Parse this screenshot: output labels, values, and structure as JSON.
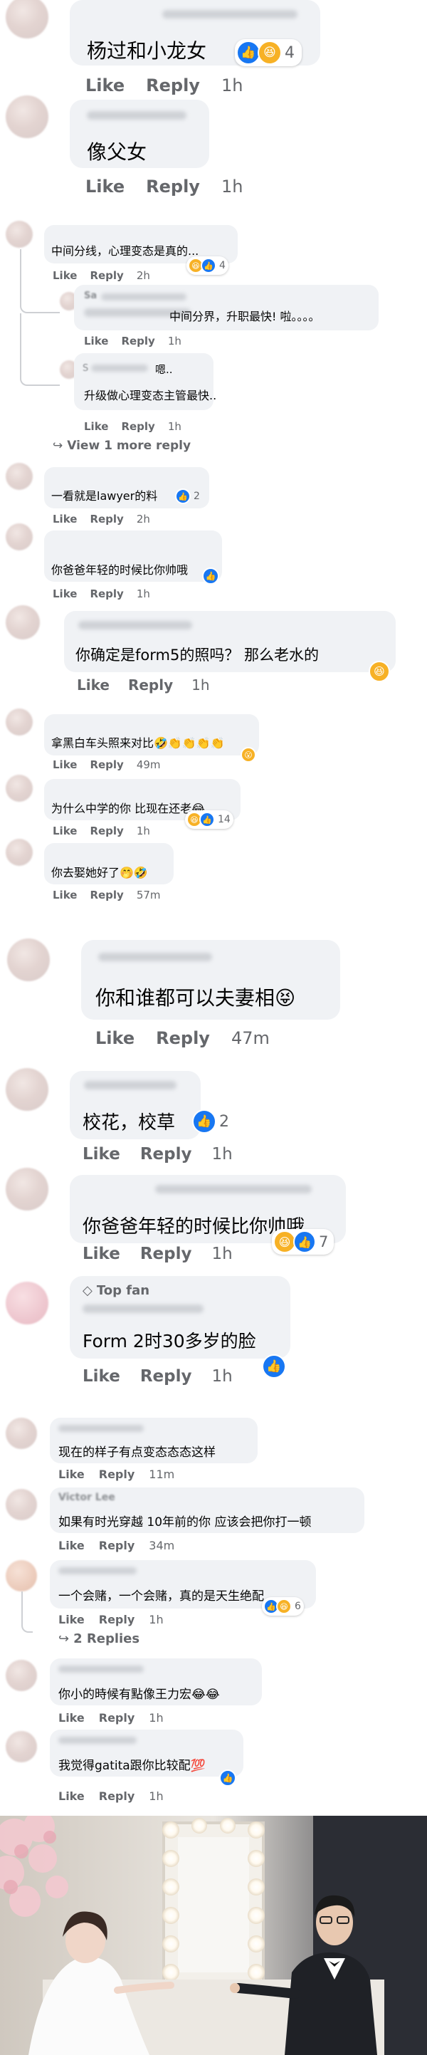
{
  "actions": {
    "like": "Like",
    "reply": "Reply"
  },
  "comments": [
    {
      "text": "杨过和小龙女",
      "time": "1h",
      "react_count": "4"
    },
    {
      "text": "像父女",
      "time": "1h"
    },
    {
      "text": "中间分线，心理变态是真的...",
      "time": "2h",
      "react_count": "4",
      "replies": [
        {
          "name_fragment": "Sa",
          "text": "中间分界，升职最快! 啦。。。。",
          "time": "1h"
        },
        {
          "name_fragment": "S",
          "name_suffix": "嗯..",
          "text": "升级做心理变态主管最快..",
          "time": "1h"
        }
      ],
      "view_more": "View 1 more reply"
    },
    {
      "text": "一看就是lawyer的料",
      "time": "2h",
      "react_count": "2"
    },
    {
      "text": "你爸爸年轻的时候比你帅哦",
      "time": "1h"
    },
    {
      "text": "你确定是form5的照吗？ 那么老水的",
      "time": "1h"
    },
    {
      "text": "拿黑白车头照来对比🤣👏👏👏👏",
      "time": "49m"
    },
    {
      "text": "为什么中学的你 比现在还老😂",
      "time": "1h",
      "react_count": "14"
    },
    {
      "text": "你去娶她好了🤭🤣",
      "time": "57m"
    },
    {
      "text": "你和谁都可以夫妻相😝",
      "time": "47m"
    },
    {
      "text": "校花，校草",
      "time": "1h",
      "react_count": "2"
    },
    {
      "text": "你爸爸年轻的时候比你帅哦",
      "time": "1h",
      "react_count": "7"
    },
    {
      "badge": "Top fan",
      "text": "Form 2时30多岁的脸",
      "time": "1h"
    },
    {
      "text": "现在的样子有点变态态态这样",
      "time": "11m"
    },
    {
      "name_fragment": "Victor Lee",
      "text": "如果有时光穿越 10年前的你 应该会把你打一顿",
      "time": "34m"
    },
    {
      "text": "一个会赌，一个会赌，真的是天生绝配",
      "time": "1h",
      "react_count": "6",
      "view_more": "2 Replies"
    },
    {
      "text": "你小的時候有點像王力宏😂😂",
      "time": "1h"
    },
    {
      "text": "我觉得gatita跟你比较配💯",
      "time": "1h"
    }
  ],
  "colors": {
    "like_blue": "#1877f2",
    "haha_yellow": "#f7b125",
    "bubble_gray": "#f0f2f5",
    "meta_gray": "#65676b"
  }
}
